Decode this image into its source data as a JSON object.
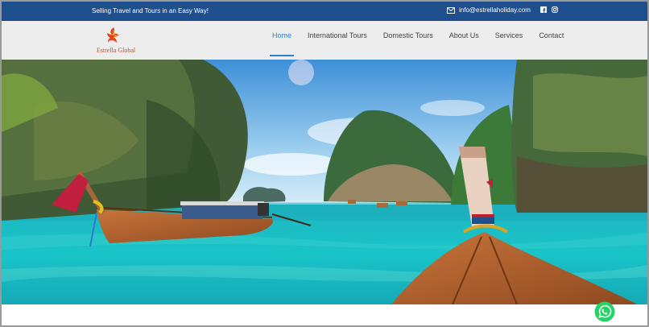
{
  "topbar": {
    "tagline": "Selling Travel and Tours in an Easy Way!",
    "email": "info@estrellaholiday.com",
    "social_icons": [
      "facebook-icon",
      "instagram-icon"
    ]
  },
  "brand": {
    "name": "Estrella Global",
    "logo_icon": "phoenix-bird-logo"
  },
  "nav": {
    "items": [
      {
        "label": "Home",
        "active": true
      },
      {
        "label": "International Tours",
        "active": false
      },
      {
        "label": "Domestic Tours",
        "active": false
      },
      {
        "label": "About Us",
        "active": false
      },
      {
        "label": "Services",
        "active": false
      },
      {
        "label": "Contact",
        "active": false
      }
    ]
  },
  "hero": {
    "image": "tropical lagoon with limestone cliffs and longtail boats"
  },
  "floating": {
    "whatsapp_icon": "whatsapp-icon"
  },
  "colors": {
    "topbar_bg": "#1f4e8c",
    "nav_bg": "#ededed",
    "accent": "#2d7fd2",
    "brand": "#d14a1e",
    "whatsapp": "#25d366"
  }
}
